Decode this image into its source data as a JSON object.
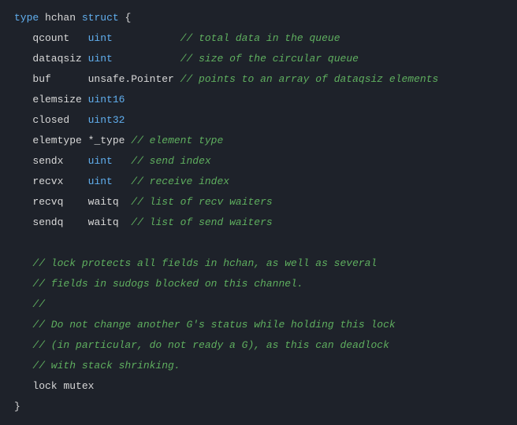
{
  "code": {
    "l1": {
      "kw1": "type",
      "id1": "hchan",
      "kw2": "struct",
      "br": "{"
    },
    "l2": {
      "id": "qcount",
      "ty": "uint",
      "cm": "// total data in the queue"
    },
    "l3": {
      "id": "dataqsiz",
      "ty": "uint",
      "cm": "// size of the circular queue"
    },
    "l4": {
      "id": "buf",
      "ty": "unsafe.Pointer",
      "cm": "// points to an array of dataqsiz elements"
    },
    "l5": {
      "id": "elemsize",
      "ty": "uint16"
    },
    "l6": {
      "id": "closed",
      "ty": "uint32"
    },
    "l7": {
      "id": "elemtype",
      "ty": "*_type",
      "cm": "// element type"
    },
    "l8": {
      "id": "sendx",
      "ty": "uint",
      "cm": "// send index"
    },
    "l9": {
      "id": "recvx",
      "ty": "uint",
      "cm": "// receive index"
    },
    "l10": {
      "id": "recvq",
      "ty": "waitq",
      "cm": "// list of recv waiters"
    },
    "l11": {
      "id": "sendq",
      "ty": "waitq",
      "cm": "// list of send waiters"
    },
    "c1": "// lock protects all fields in hchan, as well as several",
    "c2": "// fields in sudogs blocked on this channel.",
    "c3": "//",
    "c4": "// Do not change another G's status while holding this lock",
    "c5": "// (in particular, do not ready a G), as this can deadlock",
    "c6": "// with stack shrinking.",
    "l12": {
      "id": "lock",
      "ty": "mutex"
    },
    "end": "}"
  }
}
